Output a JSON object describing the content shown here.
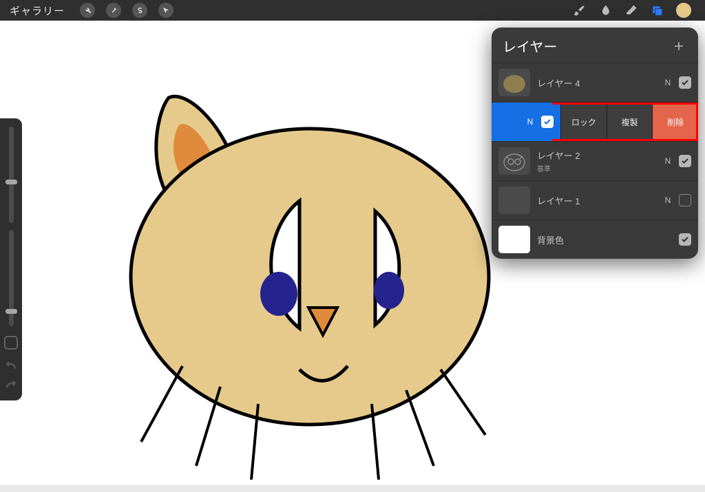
{
  "topbar": {
    "gallery_label": "ギャラリー"
  },
  "color_swatch": "#e4c98b",
  "layers_panel": {
    "title": "レイヤー",
    "rows": [
      {
        "name": "レイヤー 4",
        "sub": "",
        "blend": "N",
        "visible": true,
        "thumb": "paint"
      },
      {
        "name": "レイヤー 2",
        "sub": "基準",
        "blend": "N",
        "visible": true,
        "thumb": "outline"
      },
      {
        "name": "レイヤー 1",
        "sub": "",
        "blend": "N",
        "visible": false,
        "thumb": "blank"
      },
      {
        "name": "背景色",
        "sub": "",
        "blend": "",
        "visible": true,
        "thumb": "bg"
      }
    ],
    "swiped": {
      "blend": "N",
      "actions": {
        "lock": "ロック",
        "duplicate": "複製",
        "delete": "削除"
      }
    }
  }
}
